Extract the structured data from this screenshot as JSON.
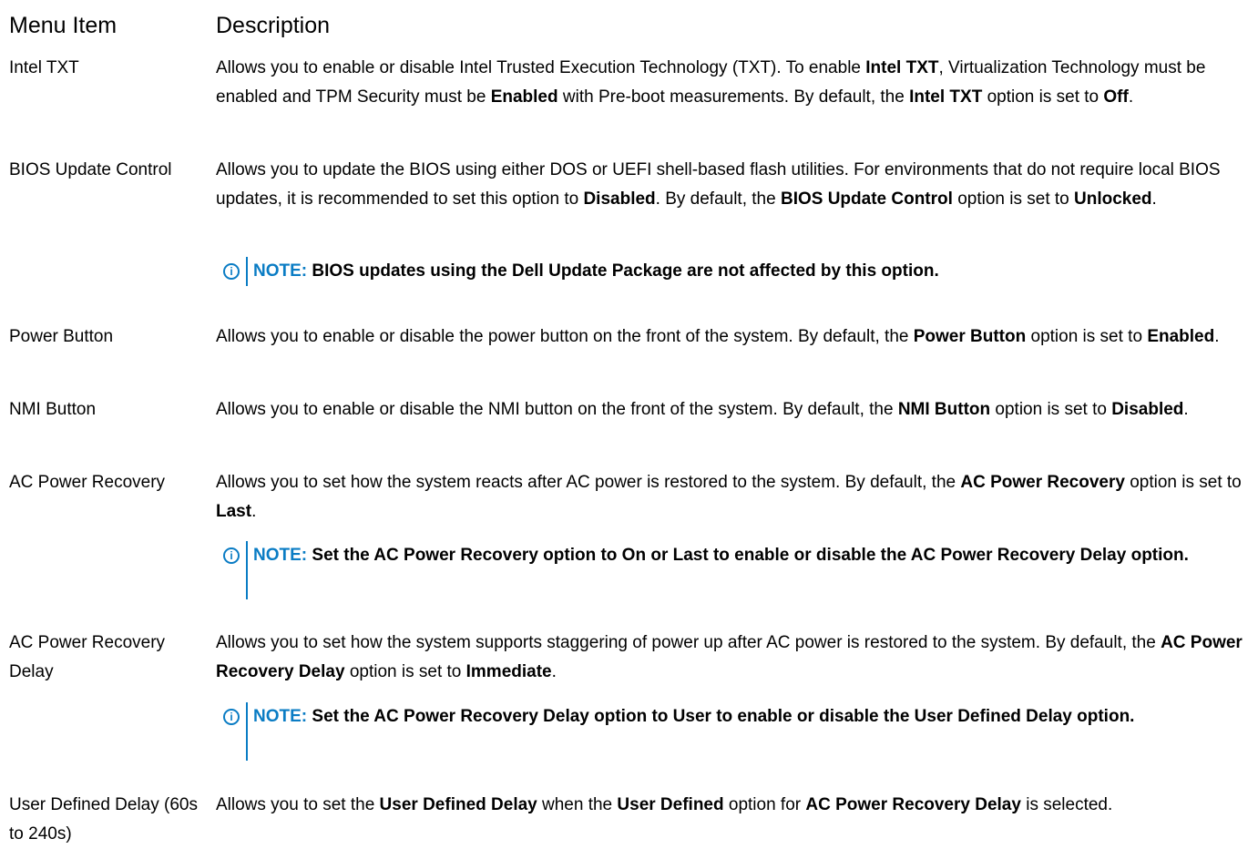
{
  "header": {
    "menu_item": "Menu Item",
    "description": "Description"
  },
  "rows": [
    {
      "label": "Intel TXT",
      "d": [
        "Allows you to enable or disable Intel Trusted Execution Technology (TXT). To enable ",
        "Intel TXT",
        ", Virtualization Technology must be enabled and TPM Security must be ",
        "Enabled",
        " with Pre-boot measurements. By default, the ",
        "Intel TXT",
        " option is set to ",
        "Off",
        "."
      ]
    },
    {
      "label": "BIOS Update Control",
      "d": [
        "Allows you to update the BIOS using either DOS or UEFI shell-based flash utilities. For environments that do not require local BIOS updates, it is recommended to set this option to ",
        "Disabled",
        ". By default, the ",
        "BIOS Update Control",
        " option is set to ",
        "Unlocked",
        "."
      ],
      "note": "BIOS updates using the Dell Update Package are not affected by this option."
    },
    {
      "label": "Power Button",
      "d": [
        "Allows you to enable or disable the power button on the front of the system. By default, the ",
        "Power Button",
        " option is set to ",
        "Enabled",
        "."
      ]
    },
    {
      "label": "NMI Button",
      "d": [
        "Allows you to enable or disable the NMI button on the front of the system. By default, the ",
        "NMI Button",
        " option is set to ",
        "Disabled",
        "."
      ]
    },
    {
      "label": "AC Power Recovery",
      "d": [
        "Allows you to set how the system reacts after AC power is restored to the system. By default, the ",
        "AC Power Recovery",
        " option is set to ",
        "Last",
        "."
      ],
      "note": "Set the AC Power Recovery option to On or Last to enable or disable the AC Power Recovery Delay option."
    },
    {
      "label": "AC Power Recovery Delay",
      "d": [
        "Allows you to set how the system supports staggering of power up after AC power is restored to the system. By default, the ",
        "AC Power Recovery Delay",
        " option is set to ",
        "Immediate",
        "."
      ],
      "note": "Set the AC Power Recovery Delay option to User to enable or disable the User Defined Delay option."
    },
    {
      "label": "User Defined Delay (60s to 240s)",
      "d": [
        "Allows you to set the ",
        "User Defined Delay",
        " when the ",
        "User Defined",
        " option for ",
        "AC Power Recovery Delay",
        " is selected."
      ]
    }
  ],
  "note_prefix": "NOTE:",
  "colors": {
    "accent": "#0a7cc4"
  }
}
